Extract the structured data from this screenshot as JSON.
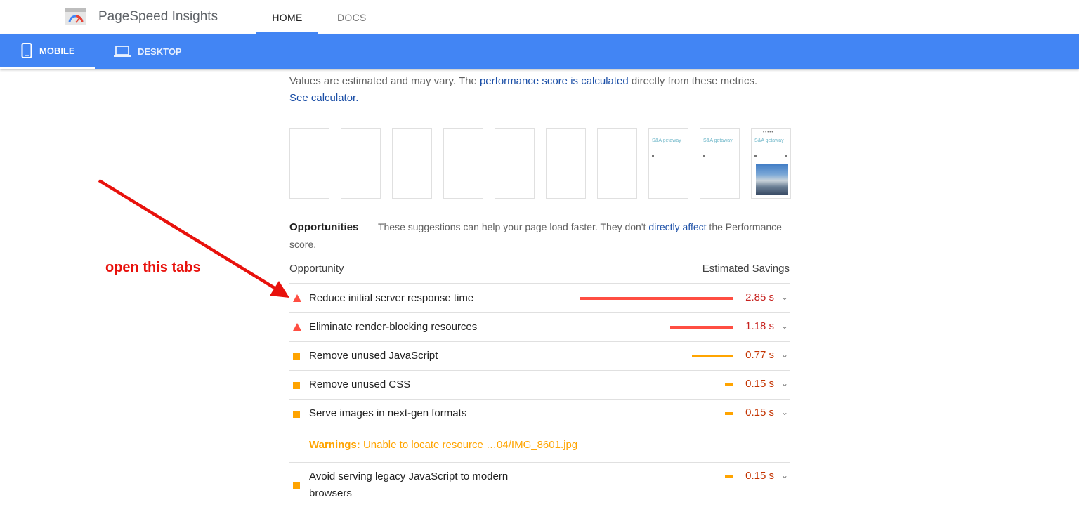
{
  "header": {
    "app_title": "PageSpeed Insights",
    "tabs": [
      "HOME",
      "DOCS"
    ],
    "active_tab": "HOME"
  },
  "device_tabs": {
    "mobile": "MOBILE",
    "desktop": "DESKTOP",
    "active": "MOBILE"
  },
  "metrics_note": {
    "prefix": "Values are estimated and may vary. The ",
    "link1": "performance score is calculated",
    "middle": " directly from these metrics. ",
    "link2": "See calculator."
  },
  "filmstrip": {
    "brand_text": "S&A getaway"
  },
  "opportunities": {
    "title": "Opportunities",
    "desc_prefix": "— These suggestions can help your page load faster. They don't ",
    "desc_link": "directly affect",
    "desc_suffix": " the Performance score.",
    "col_left": "Opportunity",
    "col_right": "Estimated Savings",
    "items": [
      {
        "label": "Reduce initial server response time",
        "savings": "2.85 s",
        "severity": "fail",
        "icon": "red-triangle-icon",
        "bar_fraction": 1.0
      },
      {
        "label": "Eliminate render-blocking resources",
        "savings": "1.18 s",
        "severity": "fail",
        "icon": "red-triangle-icon",
        "bar_fraction": 0.414
      },
      {
        "label": "Remove unused JavaScript",
        "savings": "0.77 s",
        "severity": "average",
        "icon": "orange-square-icon",
        "bar_fraction": 0.27
      },
      {
        "label": "Remove unused CSS",
        "savings": "0.15 s",
        "severity": "average",
        "icon": "orange-square-icon",
        "bar_fraction": 0.053
      },
      {
        "label": "Serve images in next-gen formats",
        "savings": "0.15 s",
        "severity": "average",
        "icon": "orange-square-icon",
        "bar_fraction": 0.053
      },
      {
        "label": "Avoid serving legacy JavaScript to modern browsers",
        "savings": "0.15 s",
        "severity": "average",
        "icon": "orange-square-icon",
        "bar_fraction": 0.053
      }
    ],
    "warning_label": "Warnings:",
    "warning_text": " Unable to locate resource …04/IMG_8601.jpg"
  },
  "annotation": {
    "text": "open this tabs",
    "color": "#e8110c"
  },
  "colors": {
    "accent_blue": "#4285f4",
    "fail_red": "#ff4e42",
    "average_orange": "#ffa400"
  }
}
